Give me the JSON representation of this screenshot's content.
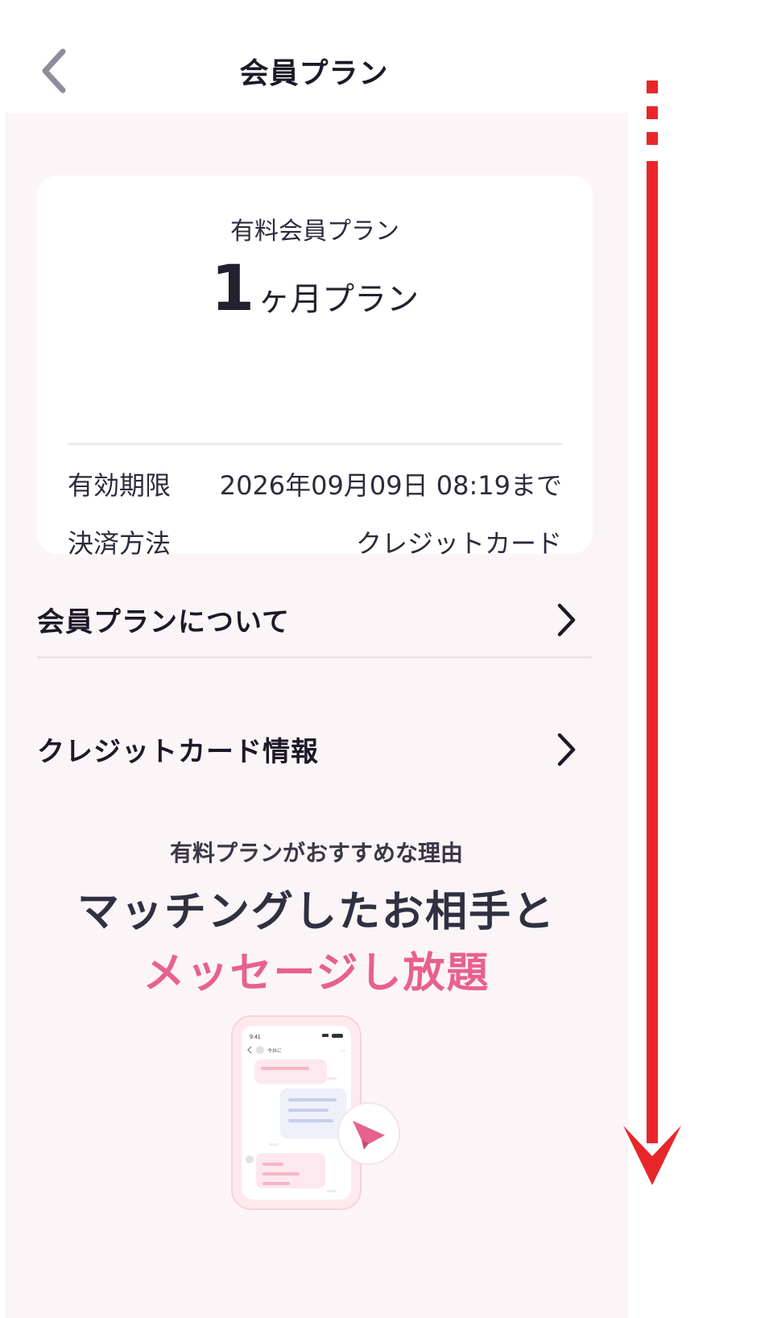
{
  "header": {
    "title": "会員プラン"
  },
  "plan_card": {
    "label": "有料会員プラン",
    "plan_number": "1",
    "plan_unit": "ヶ月プラン",
    "rows": [
      {
        "key": "有効期限",
        "value": "2026年09月09日 08:19まで"
      },
      {
        "key": "決済方法",
        "value": "クレジットカード"
      }
    ]
  },
  "menu": [
    {
      "label": "会員プランについて"
    },
    {
      "label": "クレジットカード情報"
    }
  ],
  "reason": {
    "subtitle": "有料プランがおすすめな理由",
    "title_line1": "マッチングしたお相手と",
    "title_line2": "メッセージし放題"
  },
  "illustration": {
    "status_time": "9:41",
    "chat_partner": "今井に"
  },
  "colors": {
    "accent_pink": "#e8608e",
    "background": "#fcf5f7",
    "scroll_arrow": "#e8262a"
  },
  "icons": {
    "back": "chevron-left-icon",
    "menu_chevron": "chevron-right-icon",
    "send": "paper-plane-icon"
  }
}
